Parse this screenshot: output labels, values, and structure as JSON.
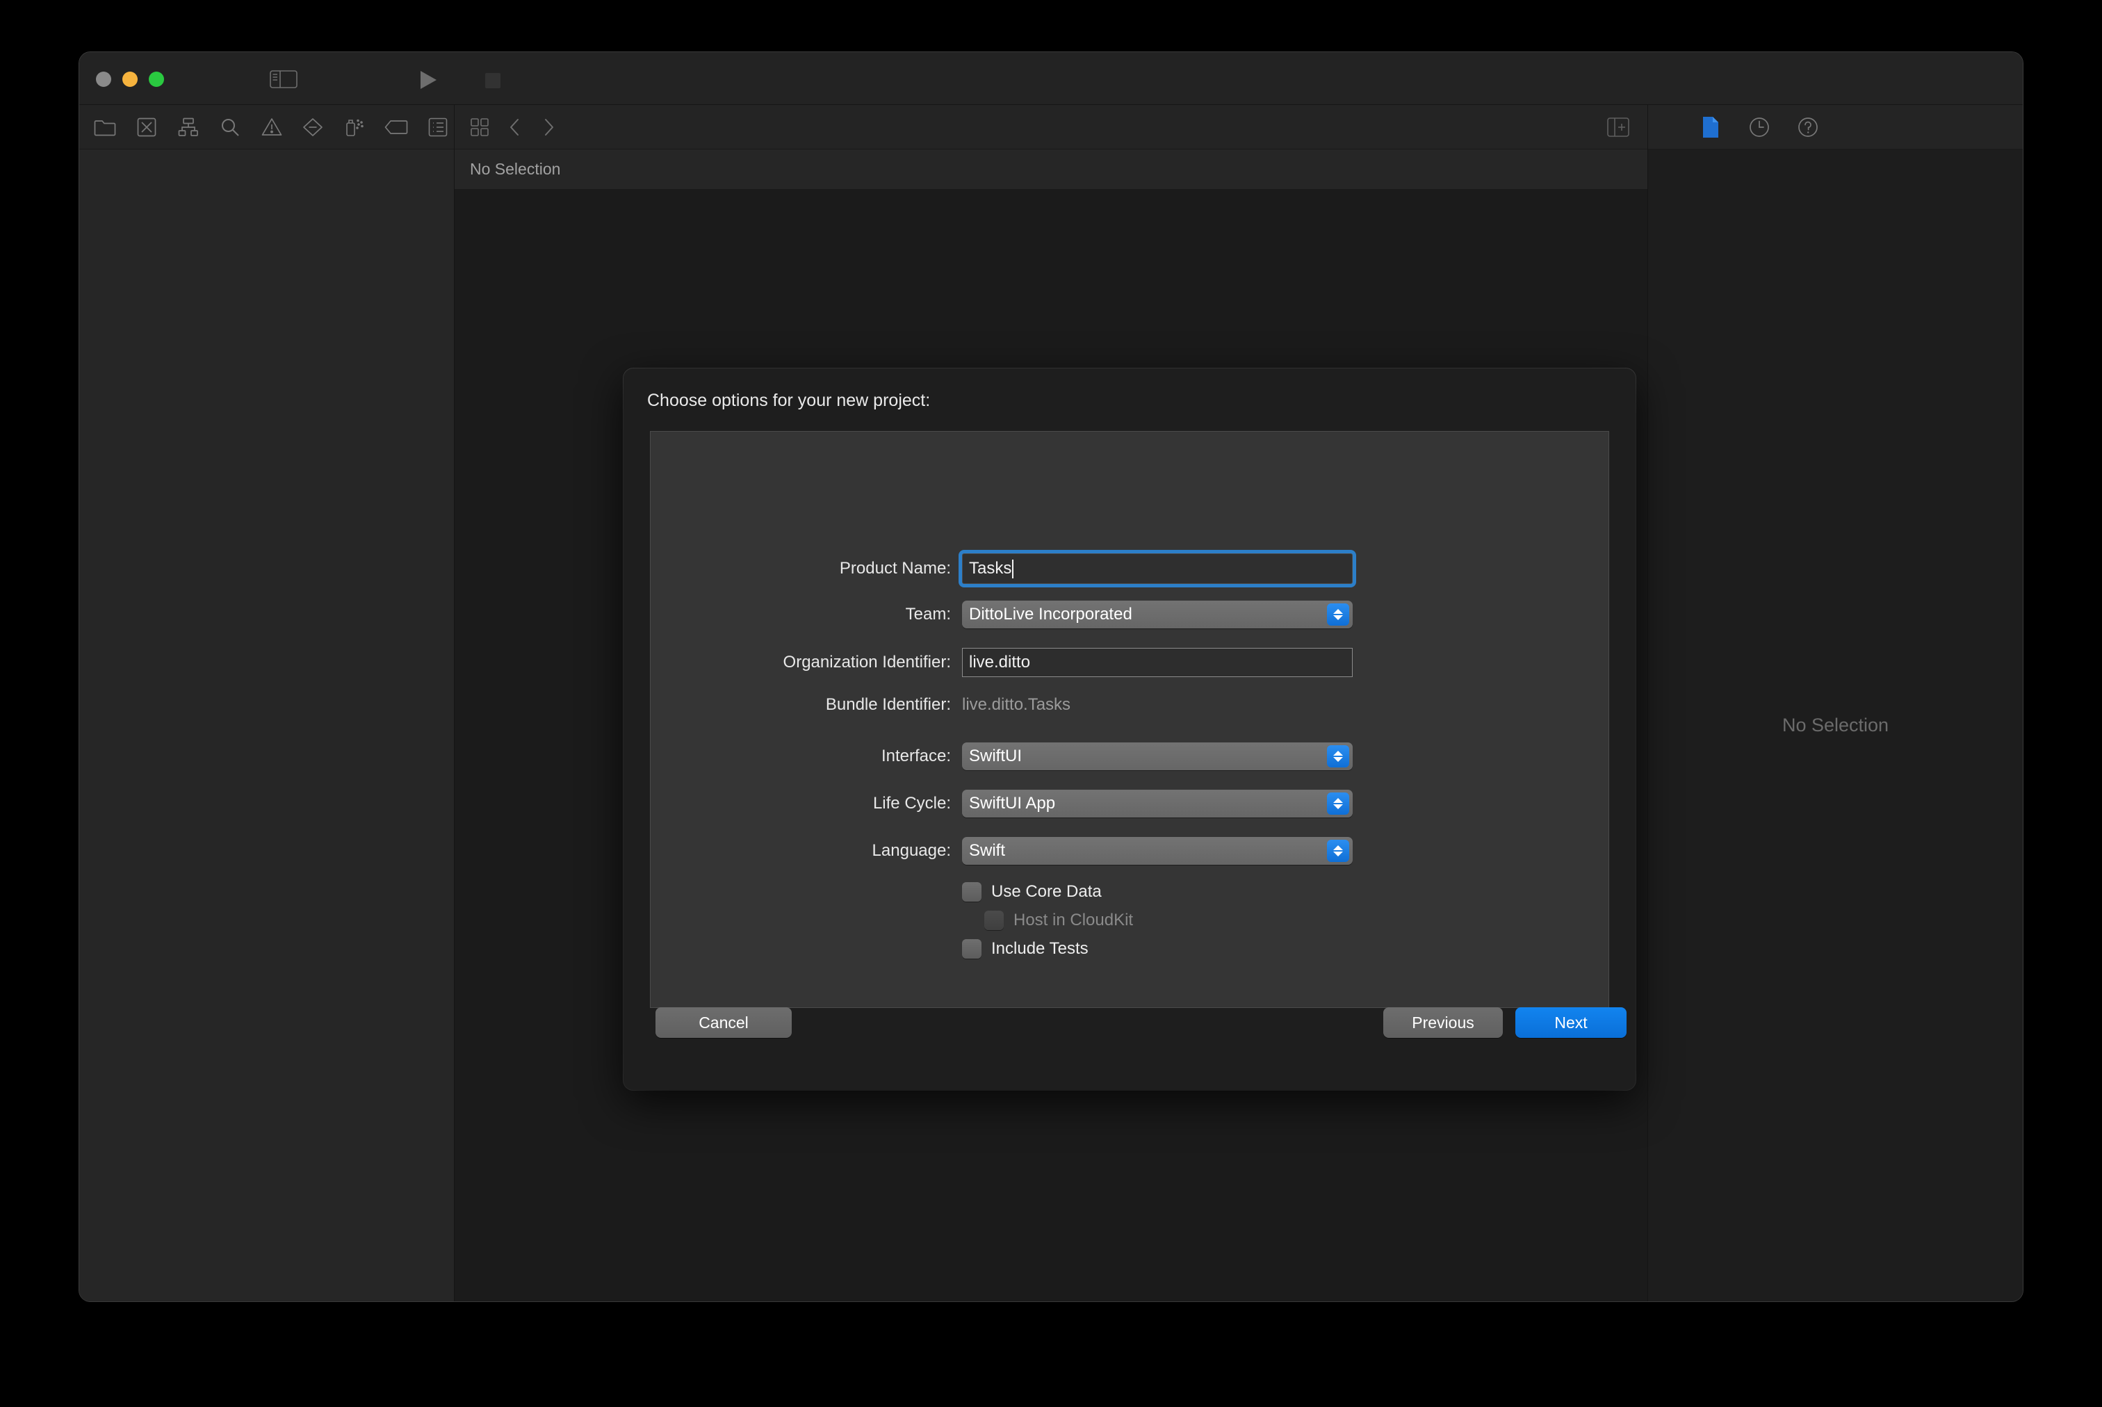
{
  "window": {
    "traffic_lights": [
      "close",
      "minimize",
      "zoom"
    ],
    "toolbar": {
      "panel_toggle_icon": "sidebar-toggle-icon",
      "run_icon": "play-icon",
      "stop_icon": "stop-icon",
      "activity_text": "",
      "add_icon": "plus-icon",
      "swap_icon": "swap-arrows-icon",
      "inspector_toggle_icon": "inspector-toggle-icon"
    }
  },
  "navigator": {
    "tabs": [
      {
        "name": "project-navigator",
        "icon": "folder-icon"
      },
      {
        "name": "source-control-navigator",
        "icon": "source-control-icon"
      },
      {
        "name": "symbol-navigator",
        "icon": "hierarchy-icon"
      },
      {
        "name": "find-navigator",
        "icon": "search-icon"
      },
      {
        "name": "issue-navigator",
        "icon": "warning-triangle-icon"
      },
      {
        "name": "test-navigator",
        "icon": "diamond-minus-icon"
      },
      {
        "name": "debug-navigator",
        "icon": "spray-icon"
      },
      {
        "name": "breakpoint-navigator",
        "icon": "tag-icon"
      },
      {
        "name": "report-navigator",
        "icon": "report-list-icon"
      }
    ]
  },
  "editor": {
    "jumpbar": {
      "related_items_icon": "related-items-icon",
      "back_icon": "chevron-left-icon",
      "forward_icon": "chevron-right-icon",
      "add_editor_icon": "add-editor-icon"
    },
    "breadcrumb": "No Selection"
  },
  "inspector": {
    "tabs": [
      {
        "name": "file-inspector",
        "icon": "file-icon",
        "active": true
      },
      {
        "name": "history-inspector",
        "icon": "clock-icon",
        "active": false
      },
      {
        "name": "quick-help-inspector",
        "icon": "question-icon",
        "active": false
      }
    ],
    "empty_text": "No Selection"
  },
  "sheet": {
    "title": "Choose options for your new project:",
    "fields": {
      "product_name": {
        "label": "Product Name:",
        "value": "Tasks",
        "focused": true
      },
      "team": {
        "label": "Team:",
        "value": "DittoLive Incorporated",
        "type": "popup"
      },
      "organization_identifier": {
        "label": "Organization Identifier:",
        "value": "live.ditto"
      },
      "bundle_identifier": {
        "label": "Bundle Identifier:",
        "value": "live.ditto.Tasks",
        "readonly": true
      },
      "interface": {
        "label": "Interface:",
        "value": "SwiftUI",
        "type": "popup"
      },
      "life_cycle": {
        "label": "Life Cycle:",
        "value": "SwiftUI App",
        "type": "popup"
      },
      "language": {
        "label": "Language:",
        "value": "Swift",
        "type": "popup"
      }
    },
    "checkboxes": [
      {
        "label": "Use Core Data",
        "checked": false,
        "disabled": false
      },
      {
        "label": "Host in CloudKit",
        "checked": false,
        "disabled": true
      },
      {
        "label": "Include Tests",
        "checked": false,
        "disabled": false
      }
    ],
    "buttons": {
      "cancel": "Cancel",
      "previous": "Previous",
      "next": "Next"
    }
  },
  "colors": {
    "accent_blue": "#0a6fd8",
    "focus_ring": "#2c7fc9",
    "window_bg": "#1d1d1d",
    "panel_bg": "#353535"
  }
}
